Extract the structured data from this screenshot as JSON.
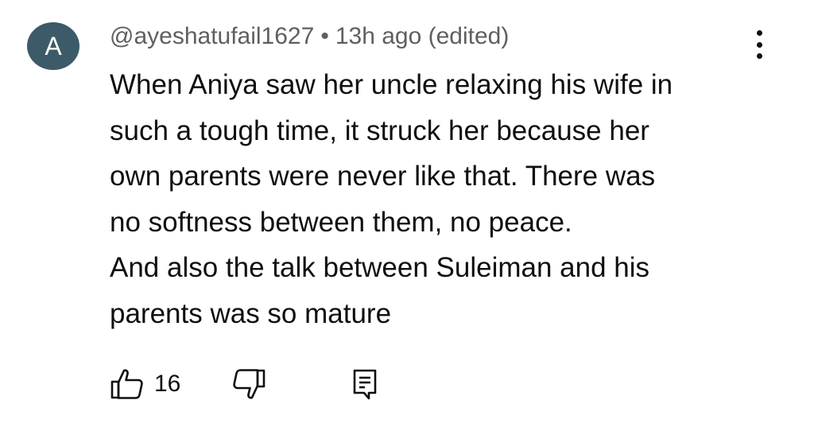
{
  "comment": {
    "avatar_letter": "A",
    "avatar_color": "#3d5a68",
    "author": "@ayeshatufail1627",
    "separator": "•",
    "timestamp": "13h ago (edited)",
    "body_lines": [
      "When Aniya saw her uncle relaxing his wife in",
      "such a tough time, it struck her because her",
      "own parents were never like that. There was",
      "no softness between them, no peace.",
      "And also the talk between Suleiman and his",
      "parents was so mature"
    ],
    "like_count": "16",
    "icons": {
      "like": "thumbs-up-icon",
      "dislike": "thumbs-down-icon",
      "reply": "reply-comment-icon",
      "menu": "more-vert-icon"
    }
  }
}
